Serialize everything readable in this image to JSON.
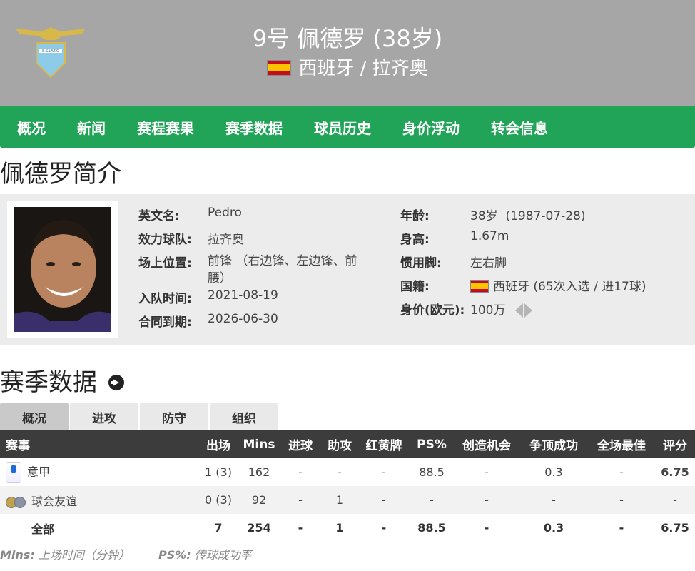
{
  "header": {
    "title": "9号 佩德罗 (38岁)",
    "subtitle": "西班牙 / 拉齐奥",
    "crest_icon": "lazio-eagle-crest-icon",
    "flag_icon": "spain-flag-icon"
  },
  "nav": {
    "items": [
      "概况",
      "新闻",
      "赛程赛果",
      "赛季数据",
      "球员历史",
      "身价浮动",
      "转会信息"
    ]
  },
  "bio": {
    "heading": "佩德罗简介",
    "left": [
      {
        "label": "英文名:",
        "value": "Pedro"
      },
      {
        "label": "效力球队:",
        "value": "拉齐奥"
      },
      {
        "label": "场上位置:",
        "value": "前锋 （右边锋、左边锋、前腰）"
      },
      {
        "label": "入队时间:",
        "value": "2021-08-19"
      },
      {
        "label": "合同到期:",
        "value": "2026-06-30"
      }
    ],
    "right": [
      {
        "label": "年龄:",
        "value": "38岁  (1987-07-28)"
      },
      {
        "label": "身高:",
        "value": "1.67m"
      },
      {
        "label": "惯用脚:",
        "value": "左右脚"
      },
      {
        "label": "国籍:",
        "value": "西班牙 (65次入选 / 进17球)"
      },
      {
        "label": "身价(欧元):",
        "value": "100万"
      }
    ]
  },
  "season": {
    "heading": "赛季数据",
    "tabs": [
      "概况",
      "进攻",
      "防守",
      "组织"
    ],
    "active_tab": "概况",
    "columns": [
      "赛事",
      "出场",
      "Mins",
      "进球",
      "助攻",
      "红黄牌",
      "PS%",
      "创造机会",
      "争顶成功",
      "全场最佳",
      "评分"
    ],
    "rows": [
      {
        "comp": "意甲",
        "icon": "serie-a-icon",
        "cells": [
          "1 (3)",
          "162",
          "-",
          "-",
          "-",
          "88.5",
          "-",
          "0.3",
          "-",
          "6.75"
        ]
      },
      {
        "comp": "球会友谊",
        "icon": "club-friendly-icon",
        "cells": [
          "0 (3)",
          "92",
          "-",
          "1",
          "-",
          "-",
          "-",
          "-",
          "-",
          "-"
        ]
      }
    ],
    "total": {
      "comp": "全部",
      "cells": [
        "7",
        "254",
        "-",
        "1",
        "-",
        "88.5",
        "-",
        "0.3",
        "-",
        "6.75"
      ]
    },
    "footnote": {
      "mins_key": "Mins:",
      "mins_desc": "上场时间（分钟）",
      "ps_key": "PS%:",
      "ps_desc": "传球成功率"
    }
  },
  "colors": {
    "header_bg": "#a6a6a6",
    "nav_bg": "#21a358",
    "table_header_bg": "#3c3c3c",
    "rating": "#d9601b"
  }
}
